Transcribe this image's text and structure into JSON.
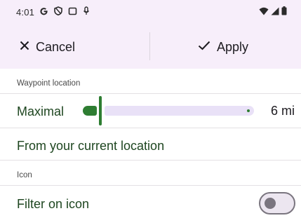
{
  "status_bar": {
    "time": "4:01",
    "left_icons": [
      "google-g-icon",
      "shield-icon",
      "screen-icon",
      "mic-icon"
    ],
    "right_icons": [
      "wifi-icon",
      "signal-icon",
      "battery-icon"
    ]
  },
  "action_bar": {
    "cancel_label": "Cancel",
    "apply_label": "Apply"
  },
  "waypoint_section": {
    "header": "Waypoint location",
    "maximal_label": "Maximal",
    "slider_value_text": "6 mi",
    "from_current_label": "From your current location"
  },
  "icon_section": {
    "header": "Icon",
    "filter_label": "Filter on icon",
    "filter_enabled": false
  },
  "colors": {
    "accent": "#2e7d32",
    "header_bg": "#f7eefa",
    "track_inactive": "#e9e1f7"
  }
}
